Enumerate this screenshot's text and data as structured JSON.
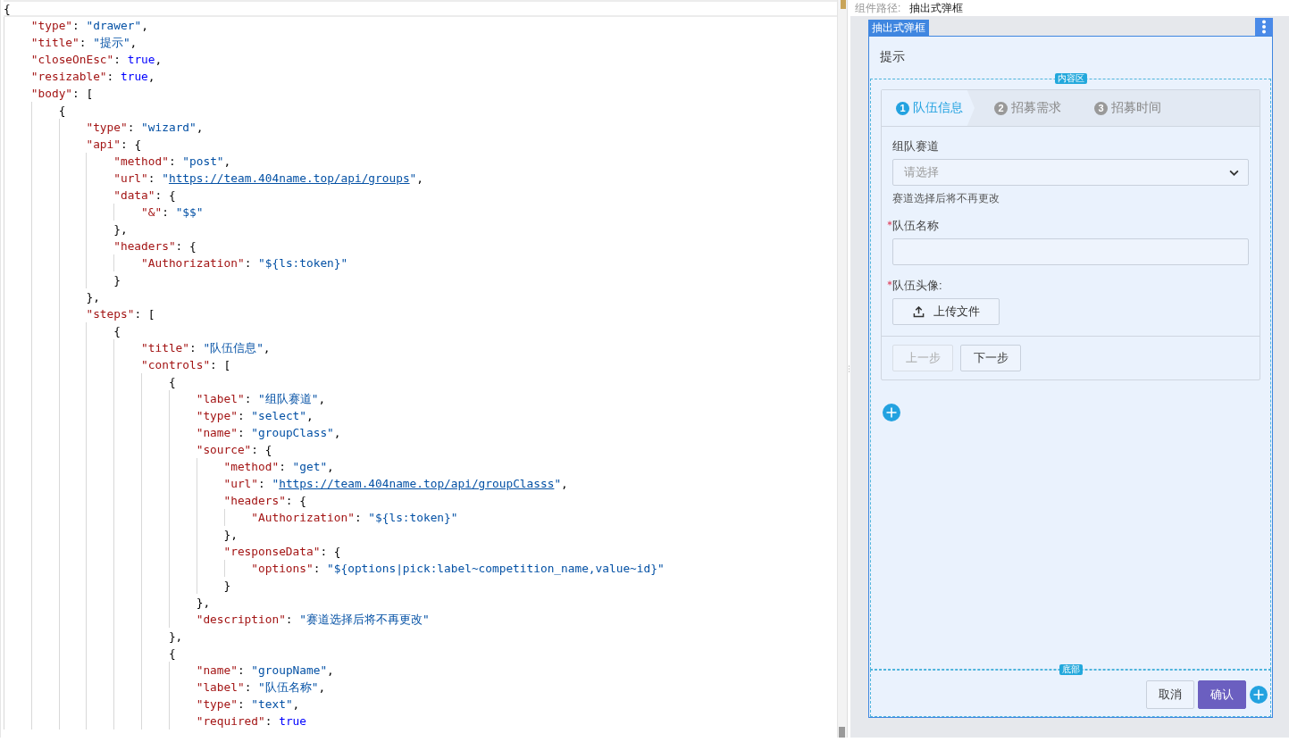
{
  "editor": {
    "lines": [
      "{",
      "    \"type\": \"drawer\",",
      "    \"title\": \"提示\",",
      "    \"closeOnEsc\": true,",
      "    \"resizable\": true,",
      "    \"body\": [",
      "        {",
      "            \"type\": \"wizard\",",
      "            \"api\": {",
      "                \"method\": \"post\",",
      "                \"url\": \"https://team.404name.top/api/groups\",",
      "                \"data\": {",
      "                    \"&\": \"$$\"",
      "                },",
      "                \"headers\": {",
      "                    \"Authorization\": \"${ls:token}\"",
      "                }",
      "            },",
      "            \"steps\": [",
      "                {",
      "                    \"title\": \"队伍信息\",",
      "                    \"controls\": [",
      "                        {",
      "                            \"label\": \"组队赛道\",",
      "                            \"type\": \"select\",",
      "                            \"name\": \"groupClass\",",
      "                            \"source\": {",
      "                                \"method\": \"get\",",
      "                                \"url\": \"https://team.404name.top/api/groupClasss\",",
      "                                \"headers\": {",
      "                                    \"Authorization\": \"${ls:token}\"",
      "                                },",
      "                                \"responseData\": {",
      "                                    \"options\": \"${options|pick:label~competition_name,value~id}\"",
      "                                }",
      "                            },",
      "                            \"description\": \"赛道选择后将不再更改\"",
      "                        },",
      "                        {",
      "                            \"name\": \"groupName\",",
      "                            \"label\": \"队伍名称\",",
      "                            \"type\": \"text\",",
      "                            \"required\": true"
    ]
  },
  "preview": {
    "breadcrumb_label": "组件路径:",
    "breadcrumb_value": "抽出式弹框",
    "drawer": {
      "tag": "抽出式弹框",
      "title": "提示",
      "body_tag": "内容区",
      "wizard": {
        "steps": [
          {
            "number": "1",
            "label": "队伍信息",
            "selected": true
          },
          {
            "number": "2",
            "label": "招募需求",
            "selected": false
          },
          {
            "number": "3",
            "label": "招募时间",
            "selected": false
          }
        ],
        "fields": [
          {
            "kind": "select",
            "label": "组队赛道",
            "required": false,
            "placeholder": "请选择",
            "description": "赛道选择后将不再更改"
          },
          {
            "kind": "text",
            "label": "队伍名称",
            "required": true
          },
          {
            "kind": "upload",
            "label": "队伍头像:",
            "required": true,
            "button": "上传文件"
          }
        ],
        "buttons": [
          {
            "label": "上一步",
            "disabled": true
          },
          {
            "label": "下一步",
            "disabled": false
          }
        ]
      },
      "footer_tag": "底部",
      "footer_buttons": [
        {
          "label": "取消",
          "primary": false
        },
        {
          "label": "确认",
          "primary": true
        }
      ]
    }
  }
}
